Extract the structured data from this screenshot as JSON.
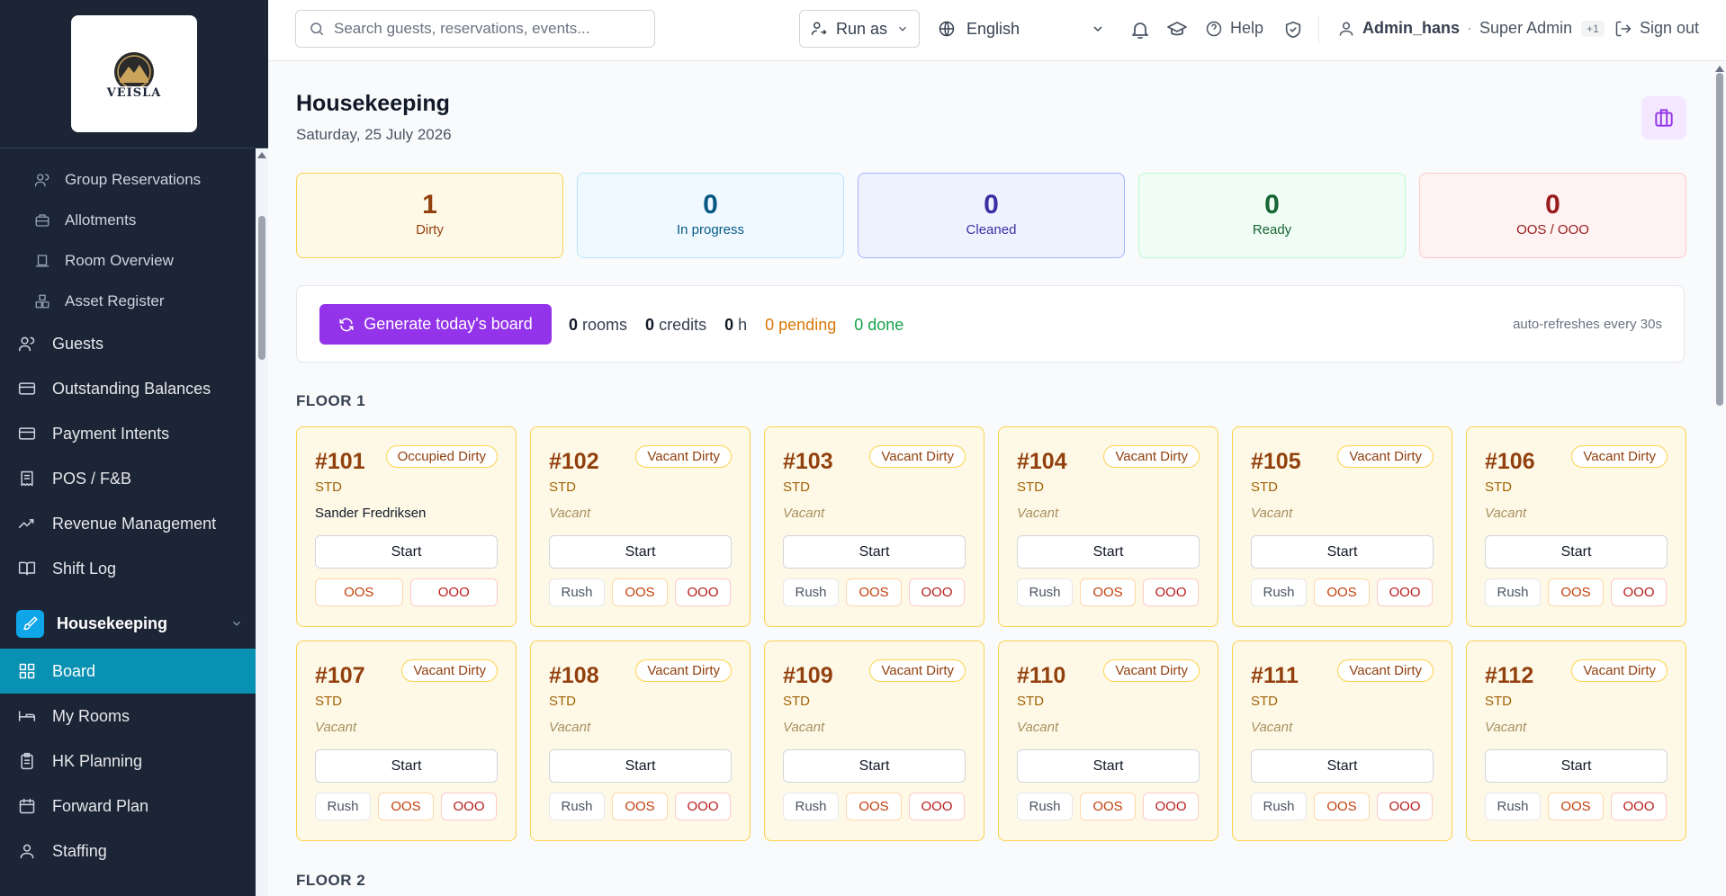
{
  "brand": {
    "logo_text": "VEISLA"
  },
  "search": {
    "placeholder": "Search guests, reservations, events..."
  },
  "topbar": {
    "run_as": "Run as",
    "language": "English",
    "help": "Help",
    "user_name": "Admin_hans",
    "separator": "·",
    "user_role": "Super Admin",
    "role_extra": "+1",
    "sign_out": "Sign out"
  },
  "sidebar": {
    "sub_items": [
      {
        "label": "Group Reservations",
        "icon": "users-icon"
      },
      {
        "label": "Allotments",
        "icon": "briefcase-icon"
      },
      {
        "label": "Room Overview",
        "icon": "bell-icon"
      },
      {
        "label": "Asset Register",
        "icon": "boxes-icon"
      }
    ],
    "items": [
      {
        "label": "Guests",
        "icon": "users-icon"
      },
      {
        "label": "Outstanding Balances",
        "icon": "card-icon"
      },
      {
        "label": "Payment Intents",
        "icon": "card-icon"
      },
      {
        "label": "POS / F&B",
        "icon": "receipt-icon"
      },
      {
        "label": "Revenue Management",
        "icon": "trend-icon"
      },
      {
        "label": "Shift Log",
        "icon": "book-icon"
      }
    ],
    "group": {
      "label": "Housekeeping",
      "icon": "brush-icon"
    },
    "group_items": [
      {
        "label": "Board",
        "icon": "grid-icon",
        "active": true
      },
      {
        "label": "My Rooms",
        "icon": "bed-icon"
      },
      {
        "label": "HK Planning",
        "icon": "clipboard-icon"
      },
      {
        "label": "Forward Plan",
        "icon": "calendar-icon"
      },
      {
        "label": "Staffing",
        "icon": "user-icon"
      }
    ]
  },
  "page": {
    "title": "Housekeeping",
    "date": "Saturday, 25 July 2026"
  },
  "stats": [
    {
      "value": "1",
      "label": "Dirty",
      "bg": "#fef9e7",
      "border": "#fcd34d",
      "color": "#92400e"
    },
    {
      "value": "0",
      "label": "In progress",
      "bg": "#f0f9ff",
      "border": "#bae6fd",
      "color": "#075985"
    },
    {
      "value": "0",
      "label": "Cleaned",
      "bg": "#eef2ff",
      "border": "#a5b4fc",
      "color": "#3730a3"
    },
    {
      "value": "0",
      "label": "Ready",
      "bg": "#f0fdf4",
      "border": "#bbf7d0",
      "color": "#166534"
    },
    {
      "value": "0",
      "label": "OOS / OOO",
      "bg": "#fef2f2",
      "border": "#fecaca",
      "color": "#991b1b"
    }
  ],
  "board": {
    "generate_label": "Generate today's board",
    "rooms_count": "0",
    "rooms_label": "rooms",
    "credits_count": "0",
    "credits_label": "credits",
    "hours_count": "0",
    "hours_label": "h",
    "pending": "0 pending",
    "done": "0 done",
    "refresh_note": "auto-refreshes every 30s"
  },
  "floors": [
    {
      "label": "FLOOR 1",
      "rooms": [
        {
          "number": "#101",
          "type": "STD",
          "status": "Occupied Dirty",
          "guest": "Sander Fredriksen",
          "rush": false
        },
        {
          "number": "#102",
          "type": "STD",
          "status": "Vacant Dirty",
          "guest": "Vacant",
          "rush": true
        },
        {
          "number": "#103",
          "type": "STD",
          "status": "Vacant Dirty",
          "guest": "Vacant",
          "rush": true
        },
        {
          "number": "#104",
          "type": "STD",
          "status": "Vacant Dirty",
          "guest": "Vacant",
          "rush": true
        },
        {
          "number": "#105",
          "type": "STD",
          "status": "Vacant Dirty",
          "guest": "Vacant",
          "rush": true
        },
        {
          "number": "#106",
          "type": "STD",
          "status": "Vacant Dirty",
          "guest": "Vacant",
          "rush": true
        },
        {
          "number": "#107",
          "type": "STD",
          "status": "Vacant Dirty",
          "guest": "Vacant",
          "rush": true
        },
        {
          "number": "#108",
          "type": "STD",
          "status": "Vacant Dirty",
          "guest": "Vacant",
          "rush": true
        },
        {
          "number": "#109",
          "type": "STD",
          "status": "Vacant Dirty",
          "guest": "Vacant",
          "rush": true
        },
        {
          "number": "#110",
          "type": "STD",
          "status": "Vacant Dirty",
          "guest": "Vacant",
          "rush": true
        },
        {
          "number": "#111",
          "type": "STD",
          "status": "Vacant Dirty",
          "guest": "Vacant",
          "rush": true
        },
        {
          "number": "#112",
          "type": "STD",
          "status": "Vacant Dirty",
          "guest": "Vacant",
          "rush": true
        }
      ]
    },
    {
      "label": "FLOOR 2",
      "rooms": []
    }
  ],
  "room_actions": {
    "start": "Start",
    "rush": "Rush",
    "oos": "OOS",
    "ooo": "OOO"
  }
}
